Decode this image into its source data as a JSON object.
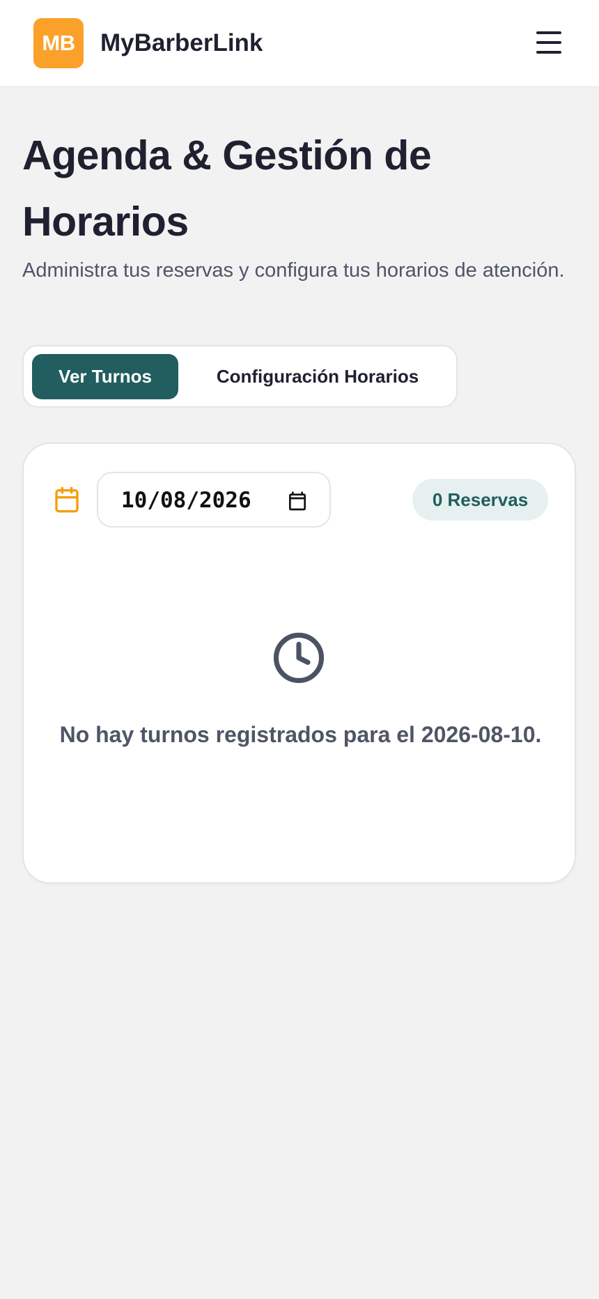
{
  "header": {
    "logo_text": "MB",
    "brand_name": "MyBarberLink",
    "menu_icon": "hamburger-menu-icon",
    "logo_color": "#fba12a"
  },
  "page": {
    "title": "Agenda & Gestión de Horarios",
    "subtitle": "Administra tus reservas y configura tus horarios de atención."
  },
  "tabs": [
    {
      "label": "Ver Turnos",
      "active": true
    },
    {
      "label": "Configuración Horarios",
      "active": false
    }
  ],
  "schedule": {
    "date_icon": "calendar-icon",
    "date_value": "10/08/2026",
    "reservations_badge": "0 Reservas",
    "empty_icon": "clock-icon",
    "empty_message": "No hay turnos registrados para el 2026-08-10."
  },
  "colors": {
    "accent": "#225d5f",
    "brand": "#fba12a",
    "background": "#f3f2f3",
    "badge_bg": "#e6f0f0"
  }
}
